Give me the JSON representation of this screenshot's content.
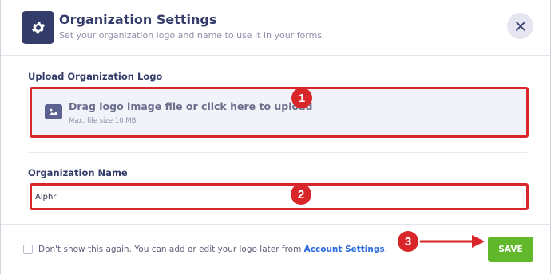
{
  "header": {
    "icon": "gear-icon",
    "title": "Organization Settings",
    "subtitle": "Set your organization logo and name to use it in your forms.",
    "close_icon": "close-icon"
  },
  "logo_section": {
    "label": "Upload Organization Logo",
    "upload_icon": "image-icon",
    "upload_text": "Drag logo image file or click here to upload",
    "upload_hint": "Max. file size 10 MB"
  },
  "name_section": {
    "label": "Organization Name",
    "value": "Alphr"
  },
  "footer": {
    "checkbox_checked": false,
    "text": "Don't show this again. You can add or edit your logo later from ",
    "link": "Account Settings",
    "suffix": ".",
    "save_label": "SAVE"
  },
  "annotations": {
    "badges": [
      "1",
      "2",
      "3"
    ],
    "color": "#d9262b"
  },
  "colors": {
    "primary": "#343c6a",
    "accent_green": "#60b82a",
    "link": "#2d6cdf",
    "highlight": "#d9262b"
  }
}
